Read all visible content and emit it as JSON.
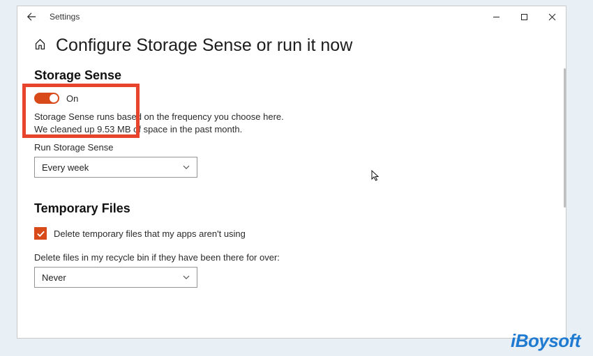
{
  "titlebar": {
    "app_name": "Settings"
  },
  "header": {
    "title": "Configure Storage Sense or run it now"
  },
  "storage_sense": {
    "heading": "Storage Sense",
    "toggle_state": "On",
    "description": "Storage Sense runs based on the frequency you choose here. We cleaned up 9.53 MB of space in the past month.",
    "run_label": "Run Storage Sense",
    "run_value": "Every week"
  },
  "temp_files": {
    "heading": "Temporary Files",
    "checkbox_label": "Delete temporary files that my apps aren't using",
    "recycle_label": "Delete files in my recycle bin if they have been there for over:",
    "recycle_value": "Never"
  },
  "watermark": "iBoysoft"
}
